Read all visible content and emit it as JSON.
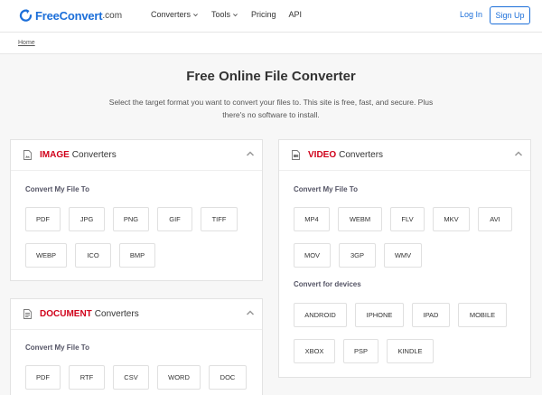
{
  "header": {
    "logo_main": "FreeConvert",
    "logo_suffix": ".com",
    "nav": [
      {
        "label": "Converters",
        "has_dropdown": true
      },
      {
        "label": "Tools",
        "has_dropdown": true
      },
      {
        "label": "Pricing",
        "has_dropdown": false
      },
      {
        "label": "API",
        "has_dropdown": false
      }
    ],
    "login": "Log In",
    "signup": "Sign Up"
  },
  "breadcrumb": "Home",
  "page": {
    "title": "Free Online File Converter",
    "subtitle": "Select the target format you want to convert your files to. This site is free, fast, and secure. Plus there's no software to install."
  },
  "cards": {
    "image": {
      "keyword": "IMAGE",
      "title_rest": "Converters",
      "section_label": "Convert My File To",
      "formats": [
        "PDF",
        "JPG",
        "PNG",
        "GIF",
        "TIFF",
        "WEBP",
        "ICO",
        "BMP"
      ]
    },
    "video": {
      "keyword": "VIDEO",
      "title_rest": "Converters",
      "section_label": "Convert My File To",
      "formats": [
        "MP4",
        "WEBM",
        "FLV",
        "MKV",
        "AVI",
        "MOV",
        "3GP",
        "WMV"
      ],
      "devices_label": "Convert for devices",
      "devices": [
        "ANDROID",
        "IPHONE",
        "IPAD",
        "MOBILE",
        "XBOX",
        "PSP",
        "KINDLE"
      ]
    },
    "document": {
      "keyword": "DOCUMENT",
      "title_rest": "Converters",
      "section_label": "Convert My File To",
      "formats": [
        "PDF",
        "RTF",
        "CSV",
        "WORD",
        "DOC"
      ]
    }
  },
  "colors": {
    "brand": "#1c6fd9",
    "keyword": "#d0021b"
  }
}
